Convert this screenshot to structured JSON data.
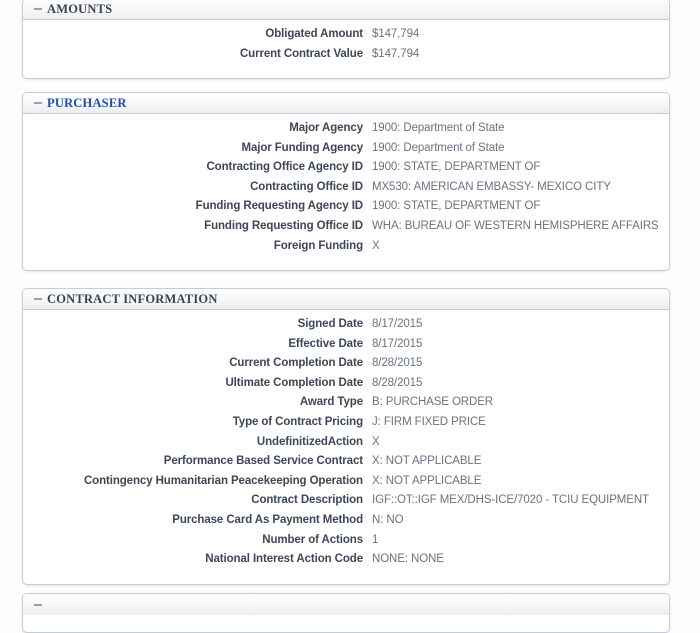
{
  "background_color": "#fdfdfd",
  "panel": {
    "border_color": "#c8ccd4",
    "header_text_color": "#3b4453",
    "header_accent_color": "#1f4fa8",
    "label_color": "#3d4757",
    "value_color": "#6b7280"
  },
  "collapse_icon_name": "minus-collapse-icon",
  "sections": [
    {
      "id": "amounts",
      "title": "AMOUNTS",
      "accent": false,
      "fields": [
        {
          "label": "Obligated Amount",
          "value": "$147,794"
        },
        {
          "label": "Current Contract Value",
          "value": "$147,794"
        }
      ]
    },
    {
      "id": "purchaser",
      "title": "PURCHASER",
      "accent": true,
      "fields": [
        {
          "label": "Major Agency",
          "value": "1900: Department of State"
        },
        {
          "label": "Major Funding Agency",
          "value": "1900: Department of State"
        },
        {
          "label": "Contracting Office Agency ID",
          "value": "1900: STATE, DEPARTMENT OF"
        },
        {
          "label": "Contracting Office ID",
          "value": "MX530: AMERICAN EMBASSY- MEXICO CITY"
        },
        {
          "label": "Funding Requesting Agency ID",
          "value": "1900: STATE, DEPARTMENT OF"
        },
        {
          "label": "Funding Requesting Office ID",
          "value": "WHA: BUREAU OF WESTERN HEMISPHERE AFFAIRS"
        },
        {
          "label": "Foreign Funding",
          "value": "X"
        }
      ]
    },
    {
      "id": "contract-information",
      "title": "CONTRACT INFORMATION",
      "accent": false,
      "fields": [
        {
          "label": "Signed Date",
          "value": "8/17/2015"
        },
        {
          "label": "Effective Date",
          "value": "8/17/2015"
        },
        {
          "label": "Current Completion Date",
          "value": "8/28/2015"
        },
        {
          "label": "Ultimate Completion Date",
          "value": "8/28/2015"
        },
        {
          "label": "Award Type",
          "value": "B: PURCHASE ORDER"
        },
        {
          "label": "Type of Contract Pricing",
          "value": "J: FIRM FIXED PRICE"
        },
        {
          "label": "UndefinitizedAction",
          "value": "X"
        },
        {
          "label": "Performance Based Service Contract",
          "value": "X: NOT APPLICABLE"
        },
        {
          "label": "Contingency Humanitarian Peacekeeping Operation",
          "value": "X: NOT APPLICABLE"
        },
        {
          "label": "Contract Description",
          "value": "IGF::OT::IGF MEX/DHS-ICE/7020 - TCIU EQUIPMENT"
        },
        {
          "label": "Purchase Card As Payment Method",
          "value": "N: NO"
        },
        {
          "label": "Number of Actions",
          "value": "1"
        },
        {
          "label": "National Interest Action Code",
          "value": "NONE: NONE"
        }
      ]
    },
    {
      "id": "next-section-partial",
      "title": "",
      "accent": false,
      "fields": []
    }
  ]
}
